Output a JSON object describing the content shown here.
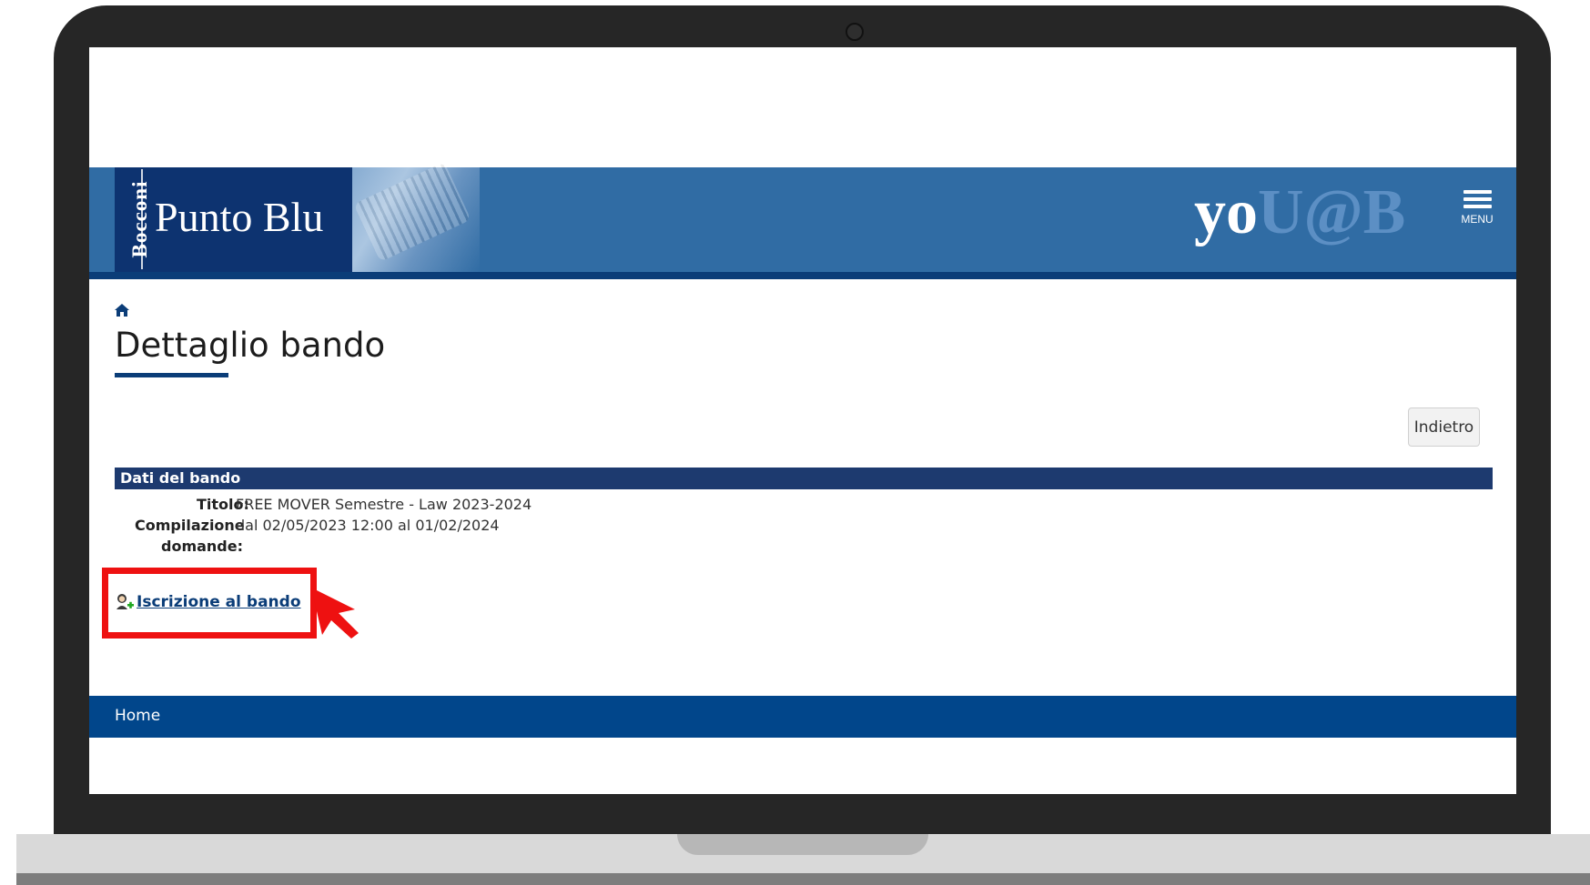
{
  "header": {
    "logo_vertical": "Bocconi",
    "logo_title": "Punto Blu",
    "brand_yo": "yo",
    "brand_rest": "U@B",
    "menu_label": "MENU"
  },
  "page": {
    "title": "Dettaglio bando",
    "back_button": "Indietro"
  },
  "section": {
    "title": "Dati del bando",
    "fields": [
      {
        "label": "Titolo:",
        "value": "FREE MOVER Semestre - Law 2023-2024"
      },
      {
        "label": "Compilazione",
        "label2": "domande:",
        "value": "dal 02/05/2023 12:00 al 01/02/2024"
      }
    ]
  },
  "action": {
    "link_text": "Iscrizione al bando"
  },
  "footer": {
    "home": "Home"
  },
  "colors": {
    "header_blue": "#306ca4",
    "navy": "#0d3370",
    "section_bar": "#1d3a6f",
    "footer_blue": "#01468b",
    "highlight_red": "#ee1111"
  }
}
